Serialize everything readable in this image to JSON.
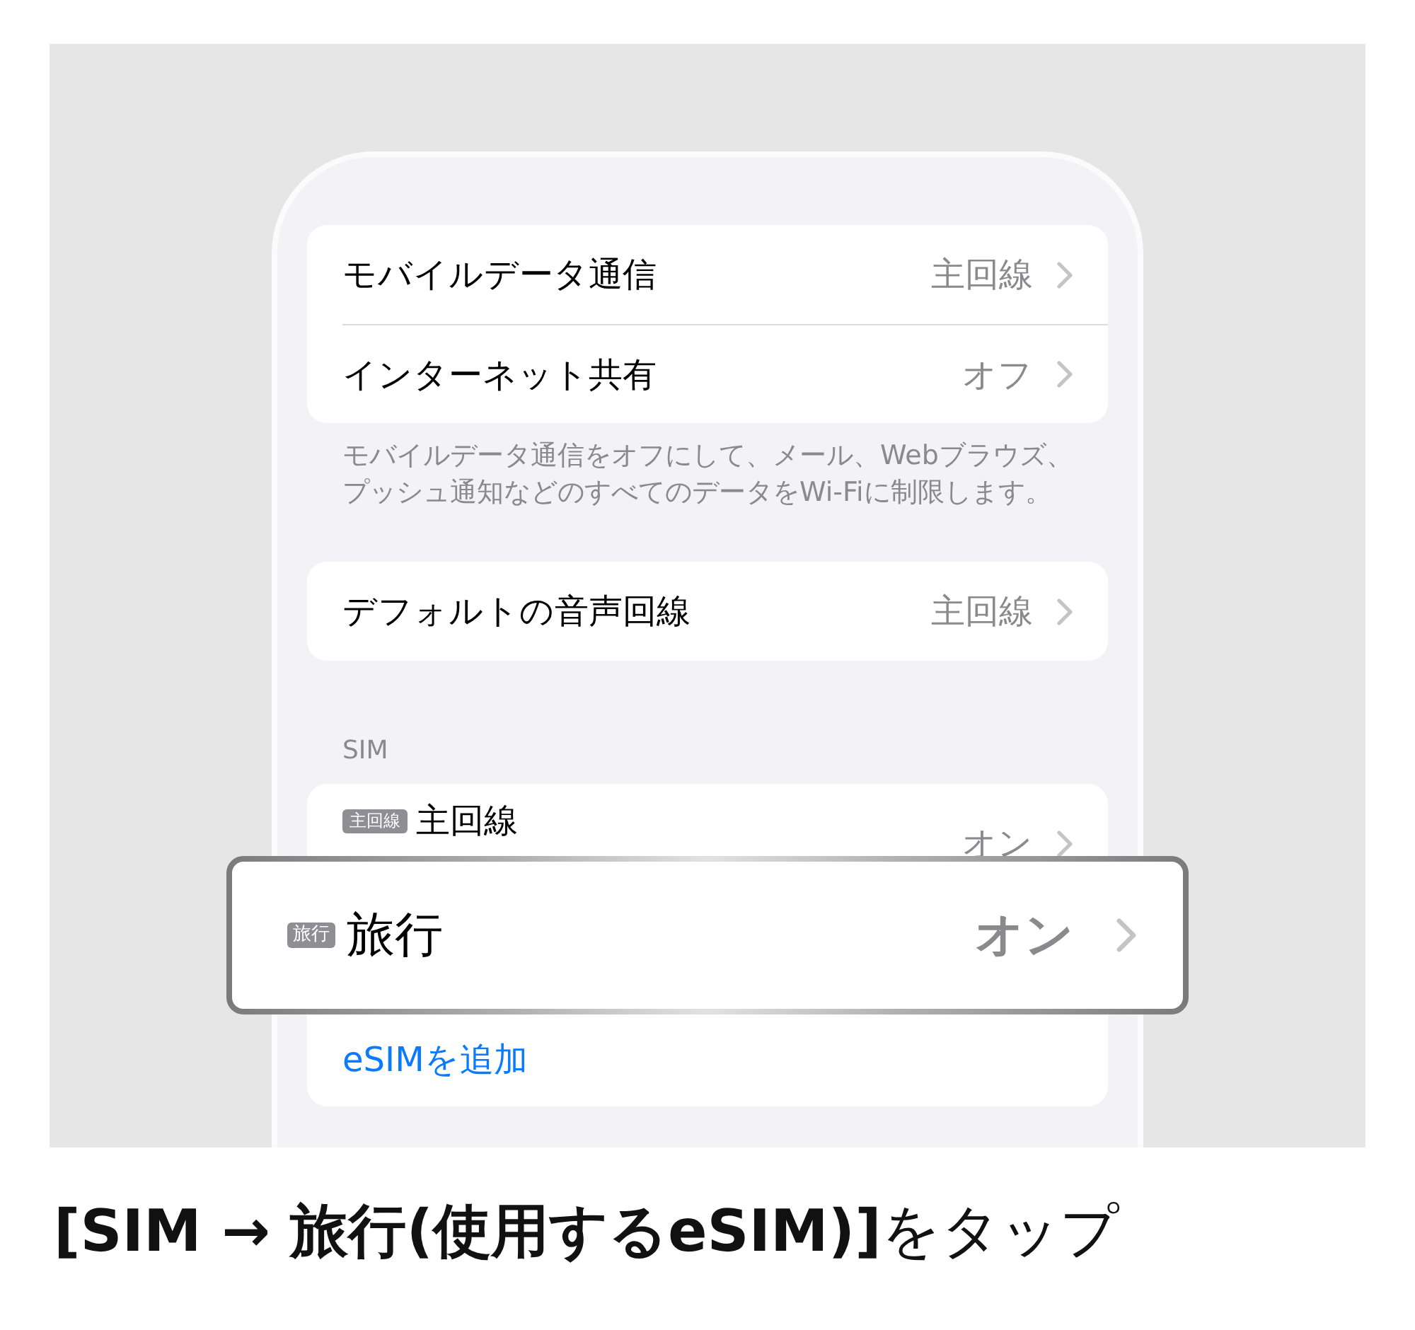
{
  "phone": {
    "groups": [
      {
        "rows": [
          {
            "label": "モバイルデータ通信",
            "value": "主回線"
          },
          {
            "label": "インターネット共有",
            "value": "オフ"
          }
        ],
        "footer": "モバイルデータ通信をオフにして、メール、Webブラウズ、プッシュ通知などのすべてのデータをWi-Fiに制限します。"
      },
      {
        "rows": [
          {
            "label": "デフォルトの音声回線",
            "value": "主回線"
          }
        ]
      },
      {
        "header": "SIM",
        "rows": [
          {
            "badge": "主回線",
            "label": "主回線",
            "value": "オン"
          }
        ],
        "link": "eSIMを追加"
      }
    ]
  },
  "zoomed_row": {
    "badge": "旅行",
    "label": "旅行",
    "value": "オン"
  },
  "caption": "**[SIM → 旅行(使用するeSIM)]**をタップ"
}
